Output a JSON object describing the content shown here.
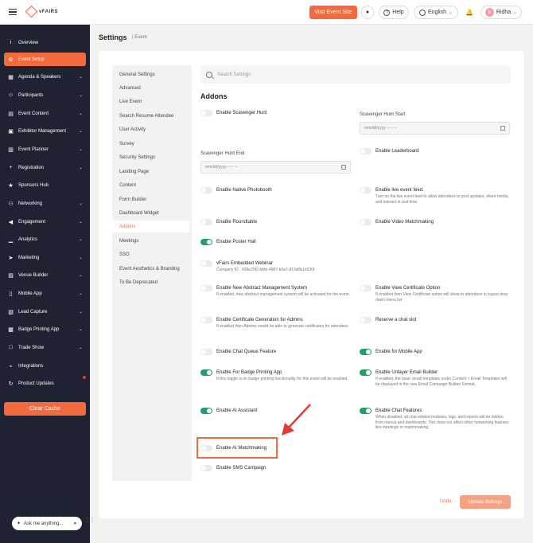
{
  "topbar": {
    "logo_text": "vFAIRS",
    "visit_label": "Visit Event Site",
    "help_label": "Help",
    "language": "English",
    "user_initial": "R",
    "user_name": "Ridha"
  },
  "sidebar": {
    "items": [
      {
        "label": "Overview",
        "icon": "info-icon",
        "arrow": false
      },
      {
        "label": "Event Setup",
        "icon": "gear-icon",
        "arrow": false
      },
      {
        "label": "Agenda & Speakers",
        "icon": "calendar-icon",
        "arrow": true
      },
      {
        "label": "Participants",
        "icon": "people-icon",
        "arrow": true
      },
      {
        "label": "Event Content",
        "icon": "content-icon",
        "arrow": true
      },
      {
        "label": "Exhibitor Management",
        "icon": "booth-icon",
        "arrow": true
      },
      {
        "label": "Event Planner",
        "icon": "planner-icon",
        "arrow": true
      },
      {
        "label": "Registration",
        "icon": "user-plus-icon",
        "arrow": true
      },
      {
        "label": "Sponsors Hub",
        "icon": "sponsor-icon",
        "arrow": false
      },
      {
        "label": "Networking",
        "icon": "network-icon",
        "arrow": true
      },
      {
        "label": "Engagement",
        "icon": "megaphone-icon",
        "arrow": true
      },
      {
        "label": "Analytics",
        "icon": "chart-icon",
        "arrow": true
      },
      {
        "label": "Marketing",
        "icon": "send-icon",
        "arrow": true
      },
      {
        "label": "Venue Builder",
        "icon": "venue-icon",
        "arrow": true
      },
      {
        "label": "Mobile App",
        "icon": "mobile-icon",
        "arrow": true
      },
      {
        "label": "Lead Capture",
        "icon": "lead-icon",
        "arrow": true
      },
      {
        "label": "Badge Printing App",
        "icon": "badge-icon",
        "arrow": true
      },
      {
        "label": "Trade Show",
        "icon": "cart-icon",
        "arrow": true
      },
      {
        "label": "Integrations",
        "icon": "plug-icon",
        "arrow": false
      },
      {
        "label": "Product Updates",
        "icon": "updates-icon",
        "arrow": false
      }
    ],
    "clear_cache_label": "Clear Cache",
    "ask_placeholder": "Ask me anything..."
  },
  "header": {
    "title": "Settings",
    "subtitle": "Event"
  },
  "settings_menu": [
    "General Settings",
    "Advanced",
    "Live Event",
    "Search Resume Attendee",
    "User Activity",
    "Survey",
    "Security Settings",
    "Landing Page",
    "Content",
    "Form Builder",
    "Dashboard Widget",
    "Addons",
    "Meetings",
    "SSO",
    "Event Aesthetics & Branding",
    "To Be Deprecated"
  ],
  "search": {
    "placeholder": "Search Settings"
  },
  "addons": {
    "title": "Addons",
    "scavenger_start_label": "Scavenger Hunt Start",
    "scavenger_end_label": "Scavenger Hunt End",
    "date_placeholder": "mm/dd/yyyy --:-- --",
    "toggles": [
      {
        "key": "scavenger",
        "label": "Enable Scavenger Hunt",
        "desc": "",
        "on": false
      },
      {
        "key": "leaderboard",
        "label": "Enable Leaderboard",
        "desc": "",
        "on": false
      },
      {
        "key": "photobooth",
        "label": "Enable Native Photobooth",
        "desc": "",
        "on": false
      },
      {
        "key": "livefeed",
        "label": "Enable live event feed.",
        "desc": "Turn on the live event feed to allow attendees to post updates, share media, and interact in real-time.",
        "on": false
      },
      {
        "key": "roundtable",
        "label": "Enable Roundtable",
        "desc": "",
        "on": false
      },
      {
        "key": "videomatch",
        "label": "Enable Video Matchmaking",
        "desc": "",
        "on": false
      },
      {
        "key": "posterhall",
        "label": "Enable Poster Hall",
        "desc": "",
        "on": true
      },
      {
        "key": "webinar",
        "label": "vFairs Embedded Webinar",
        "desc": "Company ID : 439e25f2-bbfe-4687-b0a7-819d0b1b530f",
        "on": false
      },
      {
        "key": "abstract",
        "label": "Enable New Abstract Management System",
        "desc": "If enabled, new abstract management system will be activated for the event.",
        "on": false
      },
      {
        "key": "certificate",
        "label": "Enable View Certificate Option",
        "desc": "If enabled then View Certificate option will show to attendees in logout drop down menu list",
        "on": false
      },
      {
        "key": "certadmin",
        "label": "Enable Certificate Generation for Admins",
        "desc": "If enabled then Admins would be able to generate certificates for attendees",
        "on": false
      },
      {
        "key": "chatslot",
        "label": "Reserve a chat slot",
        "desc": "",
        "on": false
      },
      {
        "key": "chatqueue",
        "label": "Enable Chat Queue Feature",
        "desc": "",
        "on": false
      },
      {
        "key": "mobileapp",
        "label": "Enable for Mobile App",
        "desc": "",
        "on": true
      },
      {
        "key": "badgeapp",
        "label": "Enable For Badge Printing App",
        "desc": "If this toggle is on badge printing functionality for this event will be enabled",
        "on": true
      },
      {
        "key": "unlayer",
        "label": "Enable Unlayer Email Builder",
        "desc": "If enabled, the basic email templates under Content > Email Templates will be displayed in the new Email Campaign Builder Format.",
        "on": true
      },
      {
        "key": "aiassistant",
        "label": "Enable AI Assistant",
        "desc": "",
        "on": true
      },
      {
        "key": "chatfeatures",
        "label": "Enable Chat Features",
        "desc": "When disabled, all chat-related modules, logs, and reports will be hidden from menus and dashboards. This does not affect other networking features like meetings or matchmaking.",
        "on": true
      },
      {
        "key": "aimatch",
        "label": "Enable AI Matchmaking",
        "desc": "",
        "on": false
      },
      {
        "key": "sms",
        "label": "Enable SMS Campaign",
        "desc": "",
        "on": false
      }
    ]
  },
  "footer": {
    "undo_label": "Undo",
    "update_label": "Update Settings"
  },
  "colors": {
    "accent": "#f26a3d",
    "sidebar_bg": "#1f2230",
    "toggle_on": "#22a06b"
  }
}
